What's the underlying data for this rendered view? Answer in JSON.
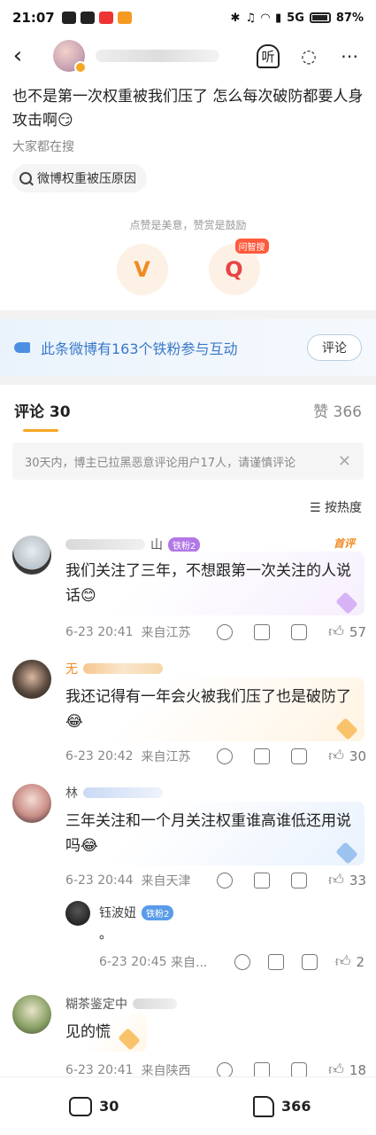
{
  "status_bar": {
    "time": "21:07",
    "signal_5g": "5G",
    "battery": "87%"
  },
  "top_bar": {
    "listen_label": "听"
  },
  "post": {
    "text": "也不是第一次权重被我们压了 怎么每次破防都要人身攻击啊😏",
    "search_hint": "大家都在搜",
    "search_chip": "微博权重被压原因",
    "encourage": "点赞是美意，赞赏是鼓励",
    "reward_v_label": "V",
    "ask_tag": "问智搜",
    "ask_label": "Q"
  },
  "fans_bar": {
    "text": "此条微博有163个铁粉参与互动",
    "button": "评论"
  },
  "tabs": {
    "comments": "评论 30",
    "likes": "赞 366"
  },
  "notice": {
    "text": "30天内，博主已拉黑恶意评论用户17人，请谨慎评论",
    "close": "✕"
  },
  "sort_label": "按热度",
  "comments": [
    {
      "name_suffix": "山",
      "badge": "铁粉2",
      "first_tag": "首评",
      "text": "我们关注了三年，不想跟第一次关注的人说话😊",
      "time": "6-23 20:41",
      "location": "来自江苏",
      "likes": "57"
    },
    {
      "name_prefix": "无",
      "badge": "",
      "text": "我还记得有一年会火被我们压了也是破防了😂",
      "time": "6-23 20:42",
      "location": "来自江苏",
      "likes": "30"
    },
    {
      "name_prefix": "林",
      "badge": "",
      "text": "三年关注和一个月关注权重谁高谁低还用说吗😂",
      "time": "6-23 20:44",
      "location": "来自天津",
      "likes": "33",
      "reply": {
        "name": "钰波妞",
        "badge": "铁粉2",
        "text": "。",
        "time": "6-23 20:45",
        "location": "来自...",
        "likes": "2"
      }
    },
    {
      "name_prefix": "糊茶鉴定中",
      "badge": "",
      "text": "见的慌",
      "time": "6-23 20:41",
      "location": "来自陕西",
      "likes": "18"
    }
  ],
  "bottom_bar": {
    "comments": "30",
    "likes": "366"
  }
}
